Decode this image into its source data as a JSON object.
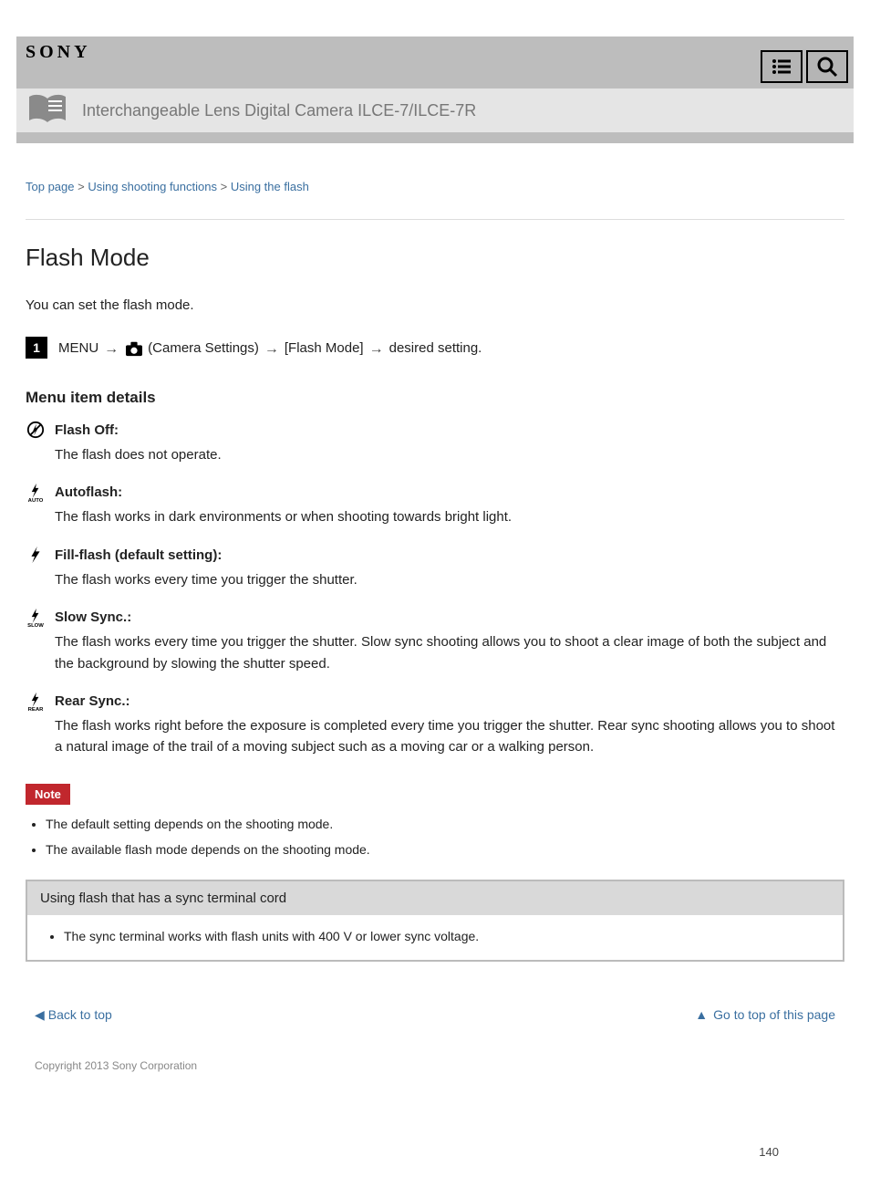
{
  "brand": "SONY",
  "titlebar": "Interchangeable Lens Digital Camera ILCE-7/ILCE-7R",
  "crumbs": {
    "top": "Top page",
    "cat": "Using shooting functions",
    "sub": "Using the flash",
    "sep": " > "
  },
  "h1": "Flash Mode",
  "lead": "You can set the flash mode.",
  "step": {
    "num": "1",
    "a": "MENU",
    "b": "(Camera Settings)",
    "c": "[Flash Mode]",
    "d": "desired setting."
  },
  "sect": "Menu item details",
  "items": [
    {
      "key": "flashoff",
      "title": "Flash Off:",
      "desc": "The flash does not operate."
    },
    {
      "key": "autoflash",
      "title": "Autoflash:",
      "desc": "The flash works in dark environments or when shooting towards bright light."
    },
    {
      "key": "fillflash",
      "title": "Fill-flash (default setting):",
      "desc": "The flash works every time you trigger the shutter."
    },
    {
      "key": "slowsync",
      "title": "Slow Sync.:",
      "desc": "The flash works every time you trigger the shutter. Slow sync shooting allows you to shoot a clear image of both the subject and the background by slowing the shutter speed."
    },
    {
      "key": "rearsync",
      "title": "Rear Sync.:",
      "desc": "The flash works right before the exposure is completed every time you trigger the shutter. Rear sync shooting allows you to shoot a natural image of the trail of a moving subject such as a moving car or a walking person."
    }
  ],
  "noteLabel": "Note",
  "notes": [
    "The default setting depends on the shooting mode.",
    "The available flash mode depends on the shooting mode."
  ],
  "hintTitle": "Using flash that has a sync terminal cord",
  "hintBody": "The sync terminal works with flash units with 400 V or lower sync voltage.",
  "footer": {
    "back": "Back to top",
    "btt": "Go to top of this page",
    "copy": "Copyright 2013 Sony Corporation"
  },
  "pageNumber": "140"
}
